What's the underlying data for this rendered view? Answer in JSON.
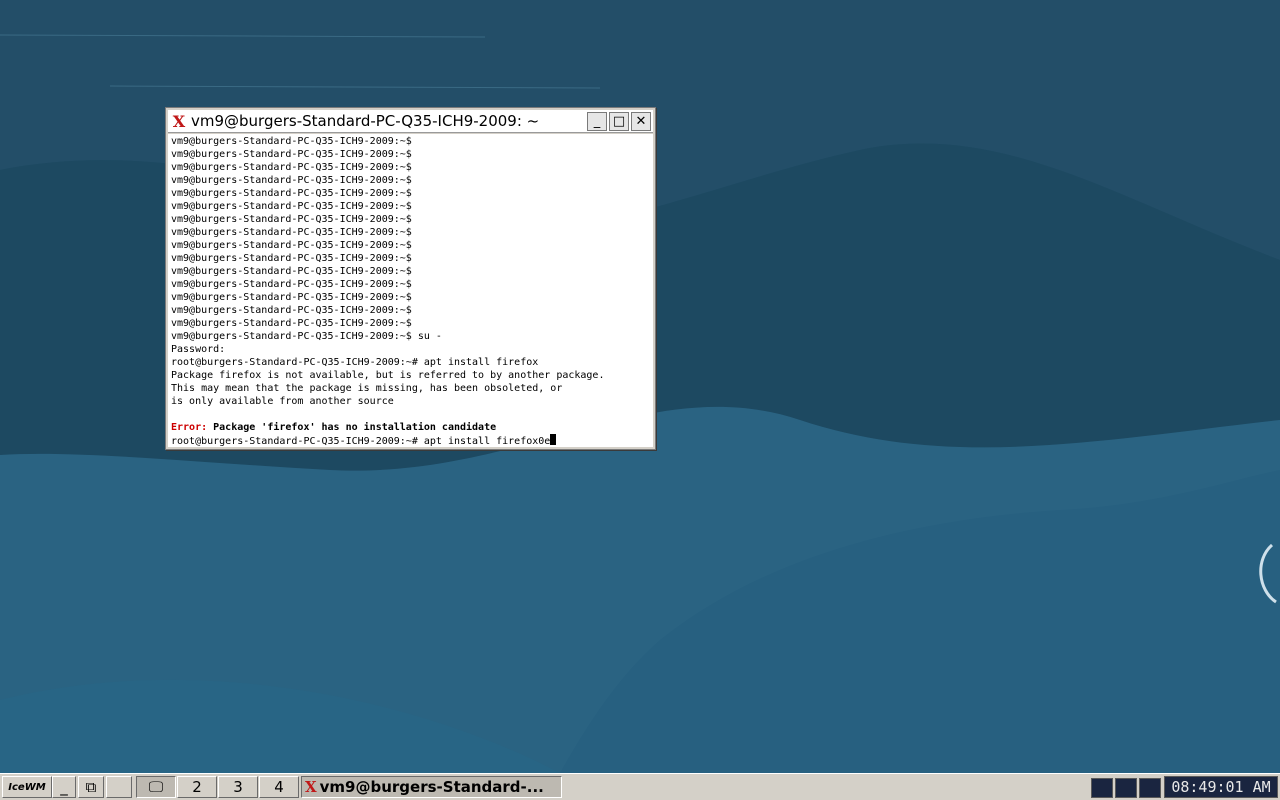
{
  "colors": {
    "desktop_dark": "#1f4d66",
    "desktop_light": "#2a6382",
    "error_red": "#cc0000",
    "taskbar": "#d4d0c8",
    "tray_dark": "#1a2540"
  },
  "terminal": {
    "app_icon": "xterm-icon",
    "title": "vm9@burgers-Standard-PC-Q35-ICH9-2009: ~",
    "lines": [
      "vm9@burgers-Standard-PC-Q35-ICH9-2009:~$",
      "vm9@burgers-Standard-PC-Q35-ICH9-2009:~$",
      "vm9@burgers-Standard-PC-Q35-ICH9-2009:~$",
      "vm9@burgers-Standard-PC-Q35-ICH9-2009:~$",
      "vm9@burgers-Standard-PC-Q35-ICH9-2009:~$",
      "vm9@burgers-Standard-PC-Q35-ICH9-2009:~$",
      "vm9@burgers-Standard-PC-Q35-ICH9-2009:~$",
      "vm9@burgers-Standard-PC-Q35-ICH9-2009:~$",
      "vm9@burgers-Standard-PC-Q35-ICH9-2009:~$",
      "vm9@burgers-Standard-PC-Q35-ICH9-2009:~$",
      "vm9@burgers-Standard-PC-Q35-ICH9-2009:~$",
      "vm9@burgers-Standard-PC-Q35-ICH9-2009:~$",
      "vm9@burgers-Standard-PC-Q35-ICH9-2009:~$",
      "vm9@burgers-Standard-PC-Q35-ICH9-2009:~$",
      "vm9@burgers-Standard-PC-Q35-ICH9-2009:~$",
      "vm9@burgers-Standard-PC-Q35-ICH9-2009:~$ su -",
      "Password:",
      "root@burgers-Standard-PC-Q35-ICH9-2009:~# apt install firefox",
      "Package firefox is not available, but is referred to by another package.",
      "This may mean that the package is missing, has been obsoleted, or",
      "is only available from another source",
      ""
    ],
    "error_label": "Error:",
    "error_message": " Package 'firefox' has no installation candidate",
    "current_prompt": "root@burgers-Standard-PC-Q35-ICH9-2009:~# apt install firefox0e",
    "buttons": {
      "minimize": "_",
      "maximize": "□",
      "close": "✕"
    }
  },
  "taskbar": {
    "start_label": "IceWM",
    "workspaces": [
      "1",
      "2",
      "3",
      "4"
    ],
    "task_title": "vm9@burgers-Standard-...",
    "clock": "08:49:01 AM"
  }
}
